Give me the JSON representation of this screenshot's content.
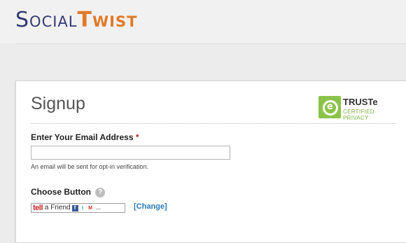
{
  "header": {
    "logo_part1": "Social",
    "logo_part2": "Twist"
  },
  "form": {
    "title": "Signup",
    "truste": {
      "name": "TRUSTe",
      "subtitle": "CERTIFIED PRIVACY"
    },
    "email": {
      "label": "Enter Your Email Address",
      "required_marker": "*",
      "value": "",
      "hint": "An email will be sent for opt-in verification."
    },
    "choose_button": {
      "label": "Choose Button",
      "help_icon": "?",
      "button_preview": {
        "logo_text": "tell",
        "text": "a Friend",
        "icons": [
          "facebook-icon",
          "twitter-icon",
          "gmail-icon",
          "more-icon"
        ]
      },
      "change_link": "[Change]"
    }
  },
  "colors": {
    "brand_blue": "#343a72",
    "brand_orange": "#e07a2a",
    "link": "#2a7ab8",
    "required": "#c62828",
    "truste_green": "#8bc34a"
  }
}
